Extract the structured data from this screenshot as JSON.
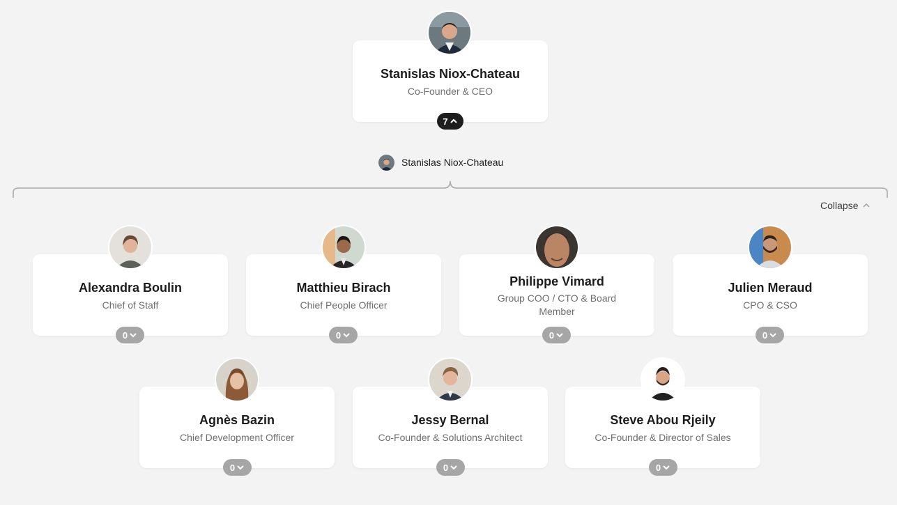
{
  "root": {
    "name": "Stanislas Niox-Chateau",
    "title": "Co-Founder & CEO",
    "reports_count": "7"
  },
  "breadcrumb": {
    "label": "Stanislas Niox-Chateau"
  },
  "controls": {
    "collapse_label": "Collapse"
  },
  "reports": [
    {
      "name": "Alexandra Boulin",
      "title": "Chief of Staff",
      "count": "0"
    },
    {
      "name": "Matthieu Birach",
      "title": "Chief People Officer",
      "count": "0"
    },
    {
      "name": "Philippe Vimard",
      "title": "Group COO / CTO & Board Member",
      "count": "0"
    },
    {
      "name": "Julien Meraud",
      "title": "CPO & CSO",
      "count": "0"
    },
    {
      "name": "Agnès Bazin",
      "title": "Chief Development Officer",
      "count": "0"
    },
    {
      "name": "Jessy Bernal",
      "title": "Co-Founder & Solutions Architect",
      "count": "0"
    },
    {
      "name": "Steve Abou Rjeily",
      "title": "Co-Founder & Director of Sales",
      "count": "0"
    }
  ],
  "colors": {
    "background": "#f3f3f3",
    "card": "#ffffff",
    "pill_dark": "#1e1e1e",
    "pill_grey": "#a6a6a6",
    "connector": "#a9a9a9"
  }
}
